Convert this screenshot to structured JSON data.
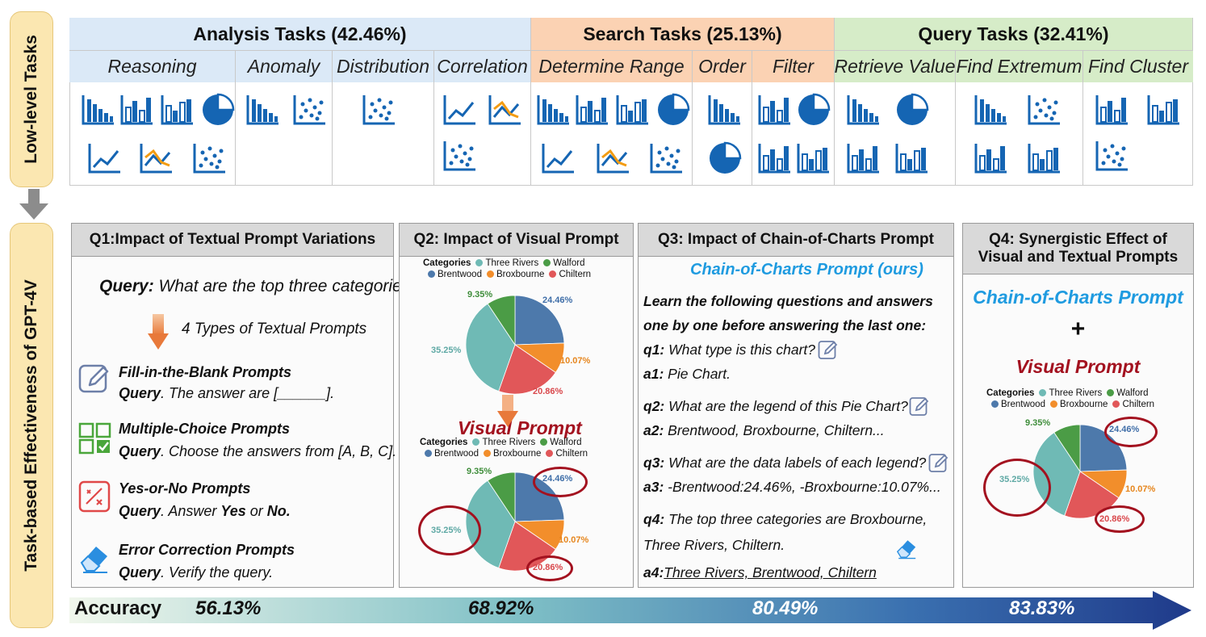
{
  "side_labels": {
    "top": "Low-level Tasks",
    "bottom": "Task-based Effectiveness of GPT-4V"
  },
  "task_groups": [
    {
      "title": "Analysis Tasks (42.46%)",
      "color": "#dbe9f7",
      "subtasks": [
        "Reasoning",
        "Anomaly",
        "Distribution",
        "Correlation"
      ]
    },
    {
      "title": "Search Tasks (25.13%)",
      "color": "#fbd2b3",
      "subtasks": [
        "Determine Range",
        "Order",
        "Filter"
      ]
    },
    {
      "title": "Query Tasks (32.41%)",
      "color": "#d6ecc8",
      "subtasks": [
        "Retrieve Value",
        "Find Extremum",
        "Find Cluster"
      ]
    }
  ],
  "icon_colors": {
    "blue": "#1565b3",
    "orange": "#f39c12"
  },
  "q1": {
    "title": "Q1:Impact of Textual Prompt Variations",
    "query_label": "Query:",
    "query_text": "What are the top three categories?",
    "types_label": "4 Types of Textual Prompts",
    "prompts": [
      {
        "icon": "pencil-icon",
        "name": "Fill-in-the-Blank Prompts",
        "bold": "Query",
        "rest": ". The answer are [______]."
      },
      {
        "icon": "checkbox-icon",
        "name": "Multiple-Choice Prompts",
        "bold": "Query",
        "rest": ". Choose the answers from [A, B, C]."
      },
      {
        "icon": "yes-no-icon",
        "name": "Yes-or-No Prompts",
        "bold": "Query",
        "rest": ". Answer ",
        "yes": "Yes",
        "or": " or ",
        "no": "No."
      },
      {
        "icon": "eraser-icon",
        "name": "Error Correction Prompts",
        "bold": "Query",
        "rest": ". Verify the query."
      }
    ]
  },
  "q2": {
    "title": "Q2: Impact of Visual Prompt",
    "visual_prompt": "Visual Prompt"
  },
  "q3": {
    "title": "Q3: Impact of Chain-of-Charts Prompt",
    "subtitle": "Chain-of-Charts Prompt (ours)",
    "intro1": "Learn the following questions and answers",
    "intro2": "one by one before answering the last one:",
    "q1": {
      "label": "q1:",
      "text": "What type is this chart?"
    },
    "a1": {
      "label": "a1:",
      "text": "Pie Chart."
    },
    "q2": {
      "label": "q2:",
      "text": "What are the legend of this Pie Chart?"
    },
    "a2": {
      "label": "a2:",
      "text": "Brentwood, Broxbourne, Chiltern..."
    },
    "q3": {
      "label": "q3:",
      "text": "What are the data labels of each legend?"
    },
    "a3": {
      "label": "a3:",
      "text": "-Brentwood:24.46%, -Broxbourne:10.07%..."
    },
    "q4": {
      "label": "q4:",
      "text1": "The top three categories are Broxbourne,",
      "text2": "Three Rivers, Chiltern."
    },
    "a4": {
      "label": "a4:",
      "text": "Three Rivers, Brentwood, Chiltern"
    }
  },
  "q4": {
    "title1": "Q4: Synergistic Effect of",
    "title2": "Visual and Textual Prompts",
    "coc": "Chain-of-Charts Prompt",
    "plus": "+",
    "visual_prompt": "Visual Prompt"
  },
  "pie": {
    "legend_title": "Categories",
    "legend": [
      {
        "name": "Three Rivers",
        "color": "#6fbab5"
      },
      {
        "name": "Walford",
        "color": "#4b9c46"
      },
      {
        "name": "Brentwood",
        "color": "#4d79ab"
      },
      {
        "name": "Broxbourne",
        "color": "#f28e2b"
      },
      {
        "name": "Chiltern",
        "color": "#e15759"
      }
    ],
    "slices": [
      {
        "name": "Brentwood",
        "value": 24.46,
        "label": "24.46%",
        "color": "#4d79ab",
        "label_color": "#3f6ea8"
      },
      {
        "name": "Broxbourne",
        "value": 10.07,
        "label": "10.07%",
        "color": "#f28e2b",
        "label_color": "#e6861e"
      },
      {
        "name": "Chiltern",
        "value": 20.86,
        "label": "20.86%",
        "color": "#e15759",
        "label_color": "#d9474b"
      },
      {
        "name": "Three Rivers",
        "value": 35.25,
        "label": "35.25%",
        "color": "#6fbab5",
        "label_color": "#5fa9a5"
      },
      {
        "name": "Walford",
        "value": 9.35,
        "label": "9.35%",
        "color": "#4b9c46",
        "label_color": "#3e8d3a"
      }
    ],
    "highlight_color": "#a3111f"
  },
  "accuracy": {
    "label": "Accuracy",
    "values": [
      "56.13%",
      "68.92%",
      "80.49%",
      "83.83%"
    ]
  }
}
